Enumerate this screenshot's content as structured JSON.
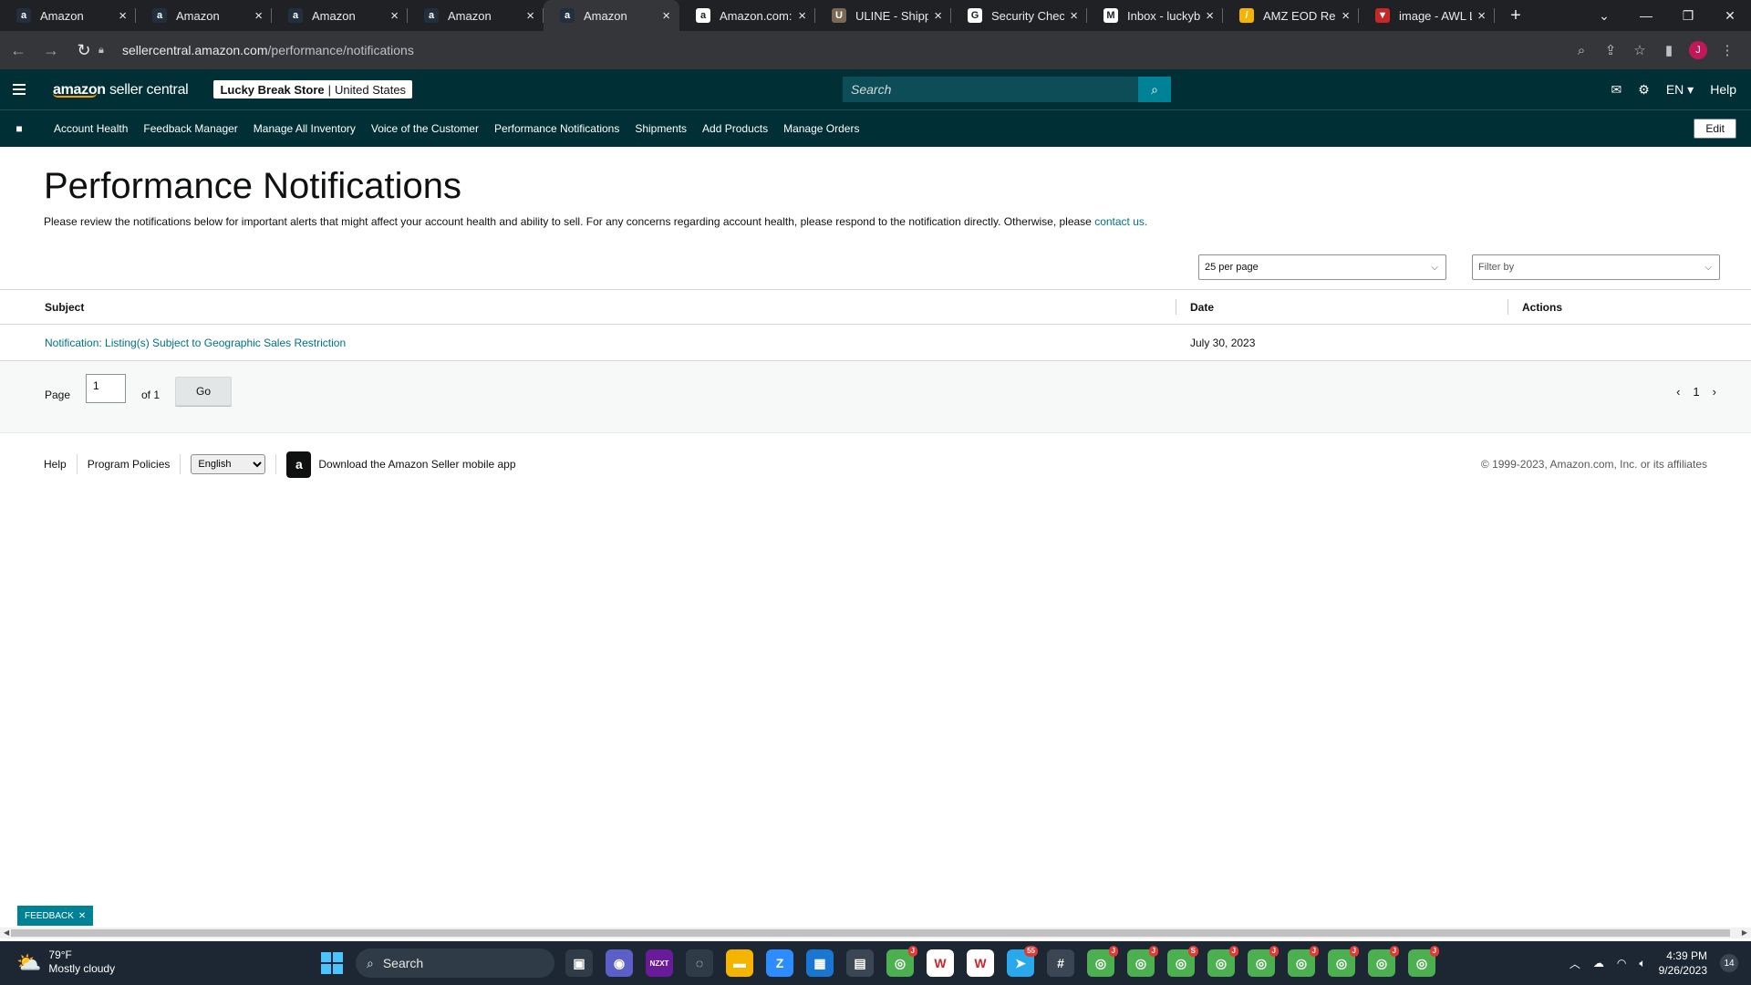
{
  "browser": {
    "tabs": [
      {
        "title": "Amazon",
        "fav": "a",
        "fav_bg": "#232f3e",
        "active": false
      },
      {
        "title": "Amazon",
        "fav": "a",
        "fav_bg": "#232f3e",
        "active": false
      },
      {
        "title": "Amazon",
        "fav": "a",
        "fav_bg": "#232f3e",
        "active": false
      },
      {
        "title": "Amazon",
        "fav": "a",
        "fav_bg": "#232f3e",
        "active": false
      },
      {
        "title": "Amazon",
        "fav": "a",
        "fav_bg": "#232f3e",
        "active": true
      },
      {
        "title": "Amazon.com: Ta",
        "fav": "a",
        "fav_bg": "#ffffff",
        "active": false
      },
      {
        "title": "ULINE - Shippin",
        "fav": "U",
        "fav_bg": "#7a6a55",
        "active": false
      },
      {
        "title": "Security Check-",
        "fav": "G",
        "fav_bg": "#ffffff",
        "active": false
      },
      {
        "title": "Inbox - luckybre",
        "fav": "M",
        "fav_bg": "#ffffff",
        "active": false
      },
      {
        "title": "AMZ EOD Repo",
        "fav": "/",
        "fav_bg": "#f4b400",
        "active": false
      },
      {
        "title": "image - AWL LA",
        "fav": "▼",
        "fav_bg": "#c62828",
        "active": false
      }
    ],
    "url_host": "sellercentral.amazon.com",
    "url_path": "/performance/notifications",
    "profile_initial": "J"
  },
  "header": {
    "logo_main": "amazon",
    "logo_sub": "seller central",
    "store_name": "Lucky Break Store",
    "store_region": "United States",
    "search_placeholder": "Search",
    "language": "EN ▾",
    "help": "Help"
  },
  "nav": {
    "items": [
      "Account Health",
      "Feedback Manager",
      "Manage All Inventory",
      "Voice of the Customer",
      "Performance Notifications",
      "Shipments",
      "Add Products",
      "Manage Orders"
    ],
    "edit": "Edit"
  },
  "page": {
    "title": "Performance Notifications",
    "intro_text": "Please review the notifications below for important alerts that might affect your account health and ability to sell. For any concerns regarding account health, please respond to the notification directly. Otherwise, please ",
    "intro_link": "contact us.",
    "per_page": "25 per page",
    "filter_by": "Filter by"
  },
  "table": {
    "columns": [
      "Subject",
      "Date",
      "Actions"
    ],
    "rows": [
      {
        "subject": "Notification: Listing(s) Subject to Geographic Sales Restriction",
        "date": "July 30, 2023",
        "actions": ""
      }
    ]
  },
  "pagination": {
    "page_label": "Page",
    "page_value": "1",
    "of_label": "of 1",
    "go": "Go",
    "current": "1"
  },
  "footer": {
    "help": "Help",
    "program_policies": "Program Policies",
    "language": "English",
    "app_text": "Download the Amazon Seller mobile app",
    "copyright": "© 1999-2023, Amazon.com, Inc. or its affiliates"
  },
  "feedback": "FEEDBACK",
  "taskbar": {
    "temp": "79°F",
    "weather": "Mostly cloudy",
    "search": "Search",
    "time": "4:39 PM",
    "date": "9/26/2023",
    "notif_count": "14",
    "apps": [
      {
        "name": "task-view",
        "label": "▣",
        "bg": "#2f3b47",
        "badge": ""
      },
      {
        "name": "teams",
        "label": "◉",
        "bg": "#5b5fc7",
        "badge": ""
      },
      {
        "name": "nzxt",
        "label": "NZXT",
        "bg": "#6a1b9a",
        "badge": ""
      },
      {
        "name": "app-circle",
        "label": "◌",
        "bg": "#2f3b47",
        "badge": ""
      },
      {
        "name": "file-explorer",
        "label": "▬",
        "bg": "#f4b400",
        "badge": ""
      },
      {
        "name": "zoom",
        "label": "Z",
        "bg": "#2d8cff",
        "badge": ""
      },
      {
        "name": "calendar",
        "label": "▦",
        "bg": "#1976d2",
        "badge": ""
      },
      {
        "name": "calculator",
        "label": "▤",
        "bg": "#3a4653",
        "badge": ""
      },
      {
        "name": "chrome-1",
        "label": "◎",
        "bg": "#4caf50",
        "badge": "J"
      },
      {
        "name": "app-wl-1",
        "label": "W",
        "bg": "#ffffff",
        "badge": ""
      },
      {
        "name": "app-wl-2",
        "label": "W",
        "bg": "#ffffff",
        "badge": ""
      },
      {
        "name": "telegram",
        "label": "➤",
        "bg": "#29a9eb",
        "badge": "55"
      },
      {
        "name": "slack",
        "label": "#",
        "bg": "#3a4653",
        "badge": ""
      },
      {
        "name": "chrome-2",
        "label": "◎",
        "bg": "#4caf50",
        "badge": "J"
      },
      {
        "name": "chrome-3",
        "label": "◎",
        "bg": "#4caf50",
        "badge": "J"
      },
      {
        "name": "chrome-4",
        "label": "◎",
        "bg": "#4caf50",
        "badge": "S"
      },
      {
        "name": "chrome-5",
        "label": "◎",
        "bg": "#4caf50",
        "badge": "J"
      },
      {
        "name": "chrome-6",
        "label": "◎",
        "bg": "#4caf50",
        "badge": "J"
      },
      {
        "name": "chrome-7",
        "label": "◎",
        "bg": "#4caf50",
        "badge": "J"
      },
      {
        "name": "chrome-8",
        "label": "◎",
        "bg": "#4caf50",
        "badge": "J"
      },
      {
        "name": "chrome-9",
        "label": "◎",
        "bg": "#4caf50",
        "badge": "J"
      },
      {
        "name": "chrome-10",
        "label": "◎",
        "bg": "#4caf50",
        "badge": "J"
      }
    ]
  },
  "colors": {
    "header_bg": "#002f36",
    "search_btn": "#008296",
    "link": "#007185",
    "tab_strip": "#202124",
    "active_tab": "#35363a"
  }
}
